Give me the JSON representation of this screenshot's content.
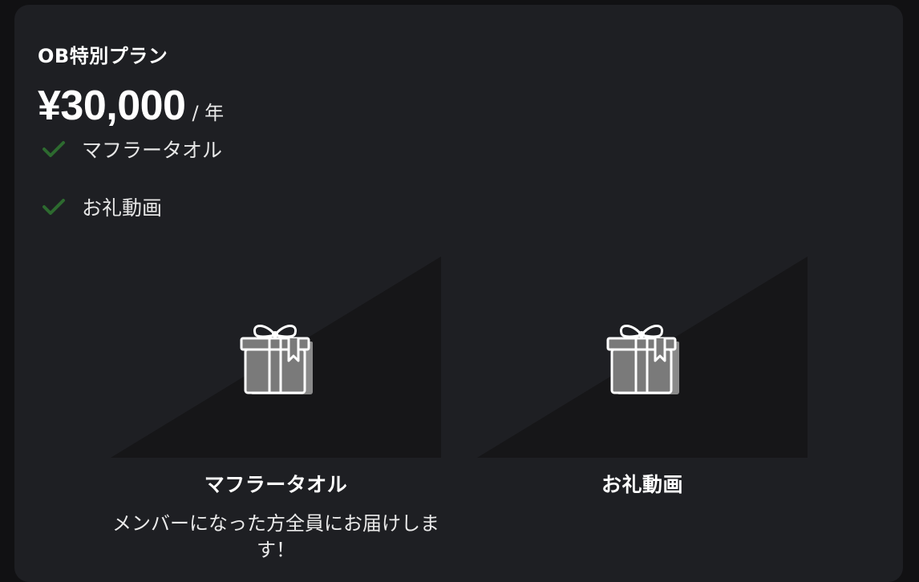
{
  "plan": {
    "title": "OB特別プラン",
    "price": "¥30,000",
    "period": "/ 年"
  },
  "features": [
    {
      "label": "マフラータオル",
      "icon": "check-icon"
    },
    {
      "label": "お礼動画",
      "icon": "check-icon"
    }
  ],
  "rewards": [
    {
      "name": "マフラータオル",
      "description": "メンバーになった方全員にお届けします！",
      "icon": "gift-icon"
    },
    {
      "name": "お礼動画",
      "description": "",
      "icon": "gift-icon"
    }
  ],
  "colors": {
    "background": "#111113",
    "card": "#1e1f23",
    "check": "#2d6a2f",
    "image_placeholder": "#161618"
  }
}
